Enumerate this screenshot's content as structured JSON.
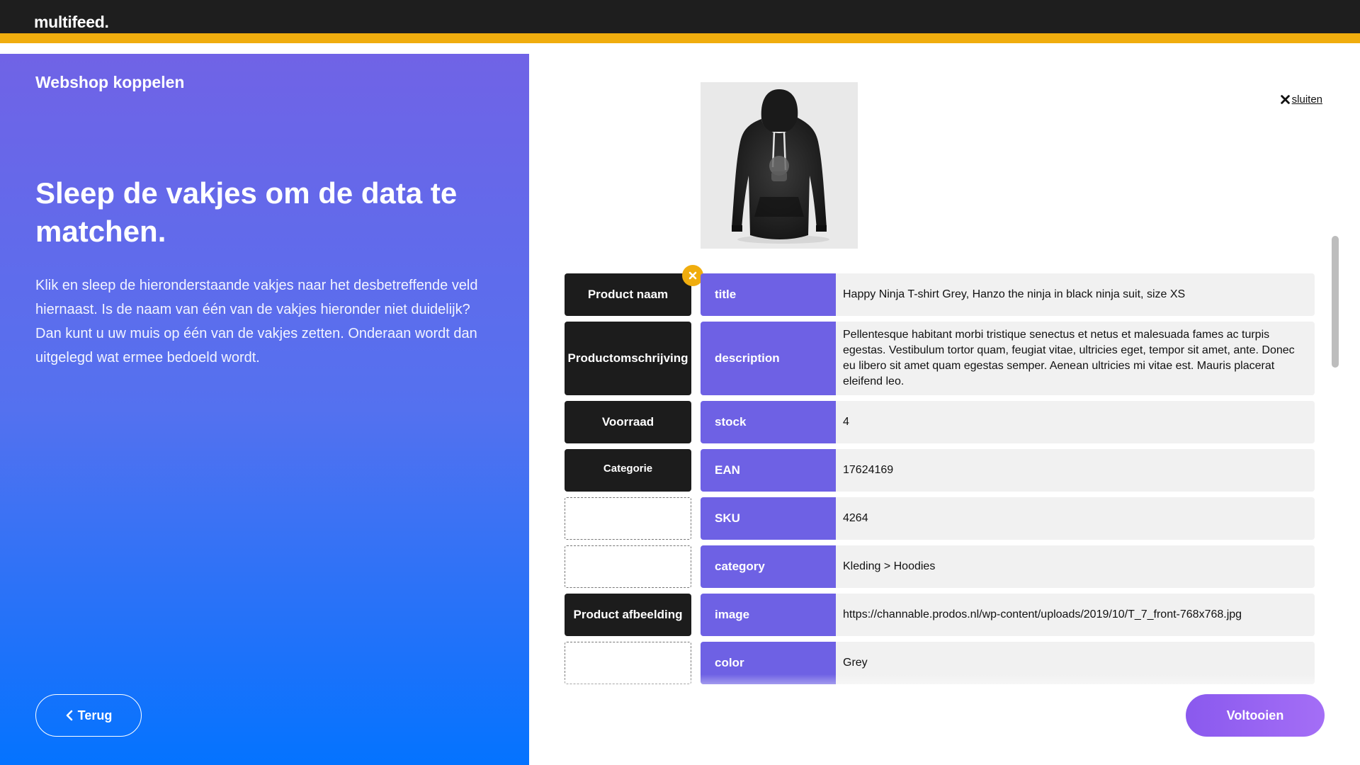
{
  "brand": {
    "logo": "multifeed.",
    "accent_color": "#f0ad0e"
  },
  "left_panel": {
    "section_title": "Webshop koppelen",
    "heading": "Sleep de vakjes om de data te matchen.",
    "intro": "Klik en sleep de hieronderstaande vakjes naar het desbetreffende veld hiernaast. Is de naam van één van de vakjes hieronder niet duidelijk? Dan kunt u uw muis op één van de vakjes zetten. Onderaan wordt dan uitgelegd wat ermee bedoeld wordt.",
    "back_label": "Terug"
  },
  "right_panel": {
    "close_label": "sluiten",
    "product_image_icon": "hoodie-product-image",
    "rows": [
      {
        "tile": "Product naam",
        "field": "title",
        "value": "Happy Ninja T-shirt Grey, Hanzo the ninja in black ninja suit, size XS",
        "has_remove": true
      },
      {
        "tile": "Productomschrijving",
        "field": "description",
        "value": "Pellentesque habitant morbi tristique senectus et netus et malesuada fames ac turpis egestas. Vestibulum tortor quam, feugiat vitae, ultricies eget, tempor sit amet, ante. Donec eu libero sit amet quam egestas semper. Aenean ultricies mi vitae est. Mauris placerat eleifend leo.",
        "has_remove": false
      },
      {
        "tile": "Voorraad",
        "field": "stock",
        "value": "4",
        "has_remove": false
      },
      {
        "tile": "Categorie",
        "field": "EAN",
        "value": "17624169",
        "has_remove": false
      },
      {
        "tile": "",
        "field": "SKU",
        "value": "4264",
        "has_remove": false
      },
      {
        "tile": "",
        "field": "category",
        "value": "Kleding > Hoodies",
        "has_remove": false
      },
      {
        "tile": "Product afbeelding",
        "field": "image",
        "value": "https://channable.prodos.nl/wp-content/uploads/2019/10/T_7_front-768x768.jpg",
        "has_remove": false
      },
      {
        "tile": "",
        "field": "color",
        "value": "Grey",
        "has_remove": false
      }
    ],
    "finish_label": "Voltooien"
  },
  "colors": {
    "field_purple": "#6e61e4",
    "tile_black": "#1c1c1c",
    "value_bg": "#f1f1f1",
    "finish_gradient_start": "#8a59ee",
    "finish_gradient_end": "#a46ef6"
  }
}
